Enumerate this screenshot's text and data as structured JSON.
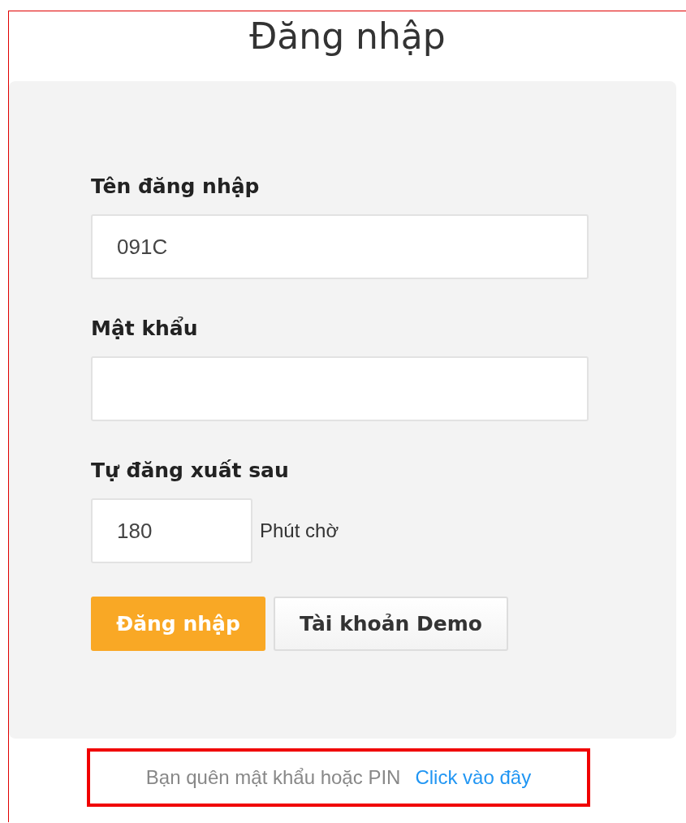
{
  "title": "Đăng nhập",
  "fields": [
    {
      "label": "Tên đăng nhập",
      "value": "091C"
    },
    {
      "label": "Mật khẩu"
    }
  ],
  "auto_logout": {
    "label": "Tự đăng xuất sau",
    "value": "180",
    "unit": "Phút chờ"
  },
  "buttons": [
    {
      "label": "Đăng nhập",
      "kind": "primary"
    },
    {
      "label": "Tài khoản Demo",
      "kind": "default"
    }
  ],
  "footer": {
    "text": "Bạn quên mật khẩu hoặc PIN",
    "link": "Click vào đây"
  }
}
